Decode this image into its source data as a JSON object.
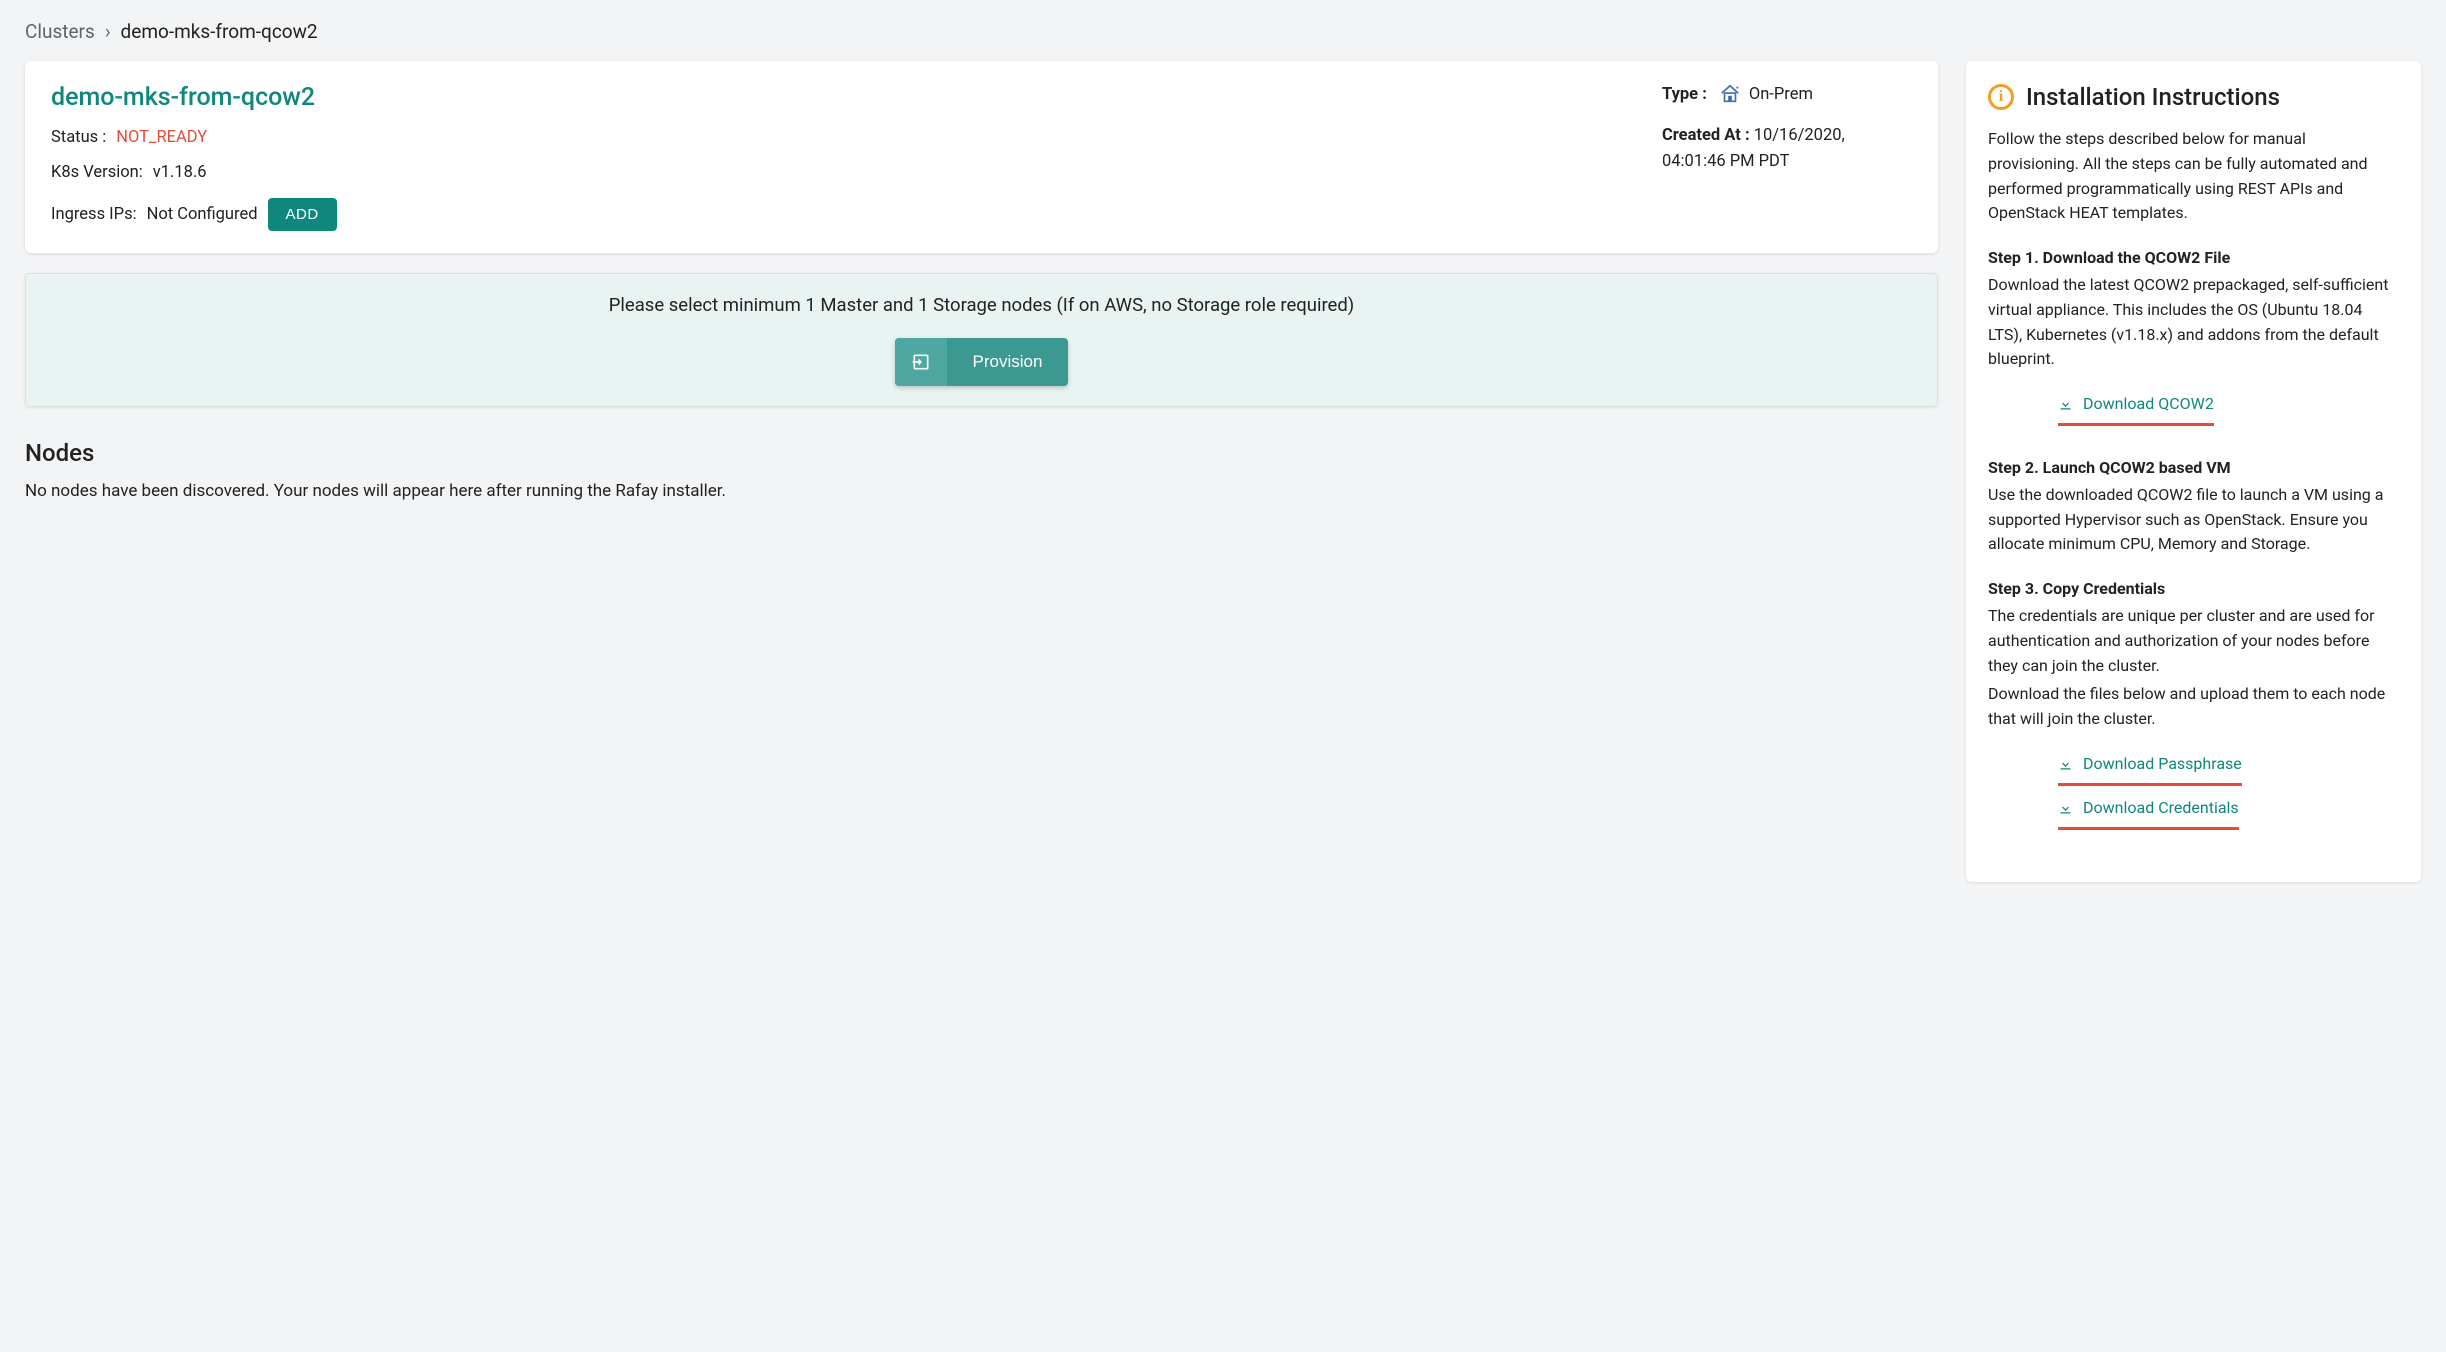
{
  "breadcrumb": {
    "parent": "Clusters",
    "separator": "›",
    "current": "demo-mks-from-qcow2"
  },
  "cluster": {
    "name": "demo-mks-from-qcow2",
    "status_label": "Status :",
    "status_value": "NOT_READY",
    "k8s_label": "K8s Version:",
    "k8s_value": "v1.18.6",
    "ingress_label": "Ingress IPs:",
    "ingress_value": "Not Configured",
    "add_button": "ADD",
    "type_label": "Type :",
    "type_value": "On-Prem",
    "created_label": "Created At :",
    "created_value": "10/16/2020, 04:01:46 PM PDT"
  },
  "alert": {
    "message": "Please select minimum 1 Master and 1 Storage nodes (If on AWS, no Storage role required)",
    "provision_label": "Provision"
  },
  "nodes": {
    "heading": "Nodes",
    "empty": "No nodes have been discovered. Your nodes will appear here after running the Rafay installer."
  },
  "instructions": {
    "title": "Installation Instructions",
    "intro": "Follow the steps described below for manual provisioning. All the steps can be fully automated and performed programmatically using REST APIs and OpenStack HEAT templates.",
    "step1_title": "Step 1. Download the QCOW2 File",
    "step1_body": "Download the latest QCOW2 prepackaged, self-sufficient virtual appliance. This includes the OS (Ubuntu 18.04 LTS), Kubernetes (v1.18.x) and addons from the default blueprint.",
    "download_qcow2": "Download QCOW2",
    "step2_title": "Step 2. Launch QCOW2 based VM",
    "step2_body": "Use the downloaded QCOW2 file to launch a VM using a supported Hypervisor such as OpenStack. Ensure you allocate minimum CPU, Memory and Storage.",
    "step3_title": "Step 3. Copy Credentials",
    "step3_body1": "The credentials are unique per cluster and are used for authentication and authorization of your nodes before they can join the cluster.",
    "step3_body2": "Download the files below and upload them to each node that will join the cluster.",
    "download_passphrase": "Download Passphrase",
    "download_credentials": "Download Credentials"
  }
}
